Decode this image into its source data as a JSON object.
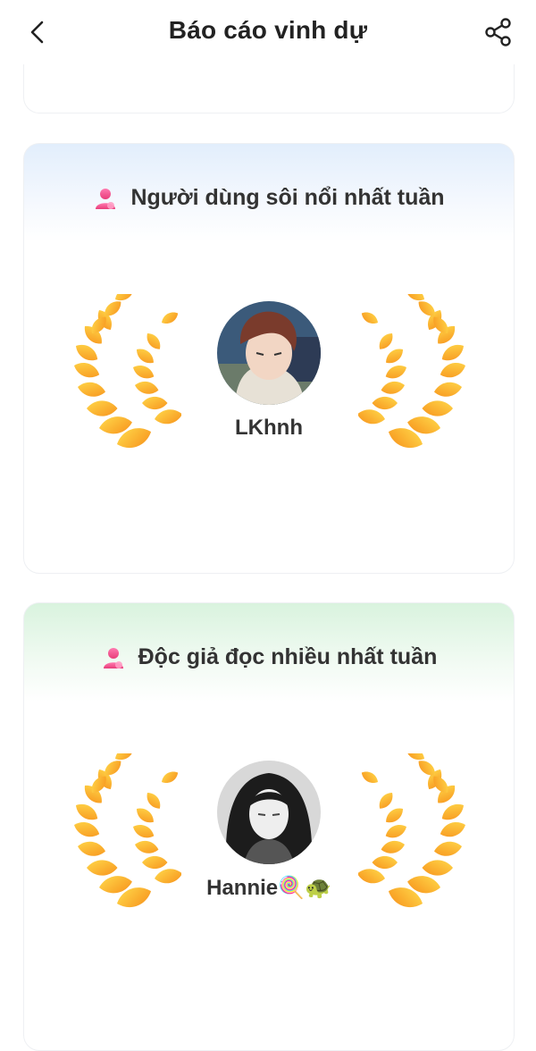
{
  "header": {
    "title": "Báo cáo vinh dự",
    "back_icon": "chevron-left-icon",
    "share_icon": "share-icon"
  },
  "cards": [
    {
      "title": "Người dùng sôi nổi nhất tuần",
      "icon": "user-icon",
      "accent": "#e2eefc",
      "user": {
        "name": "LKhnh"
      }
    },
    {
      "title": "Độc giả đọc nhiều nhất tuần",
      "icon": "user-icon",
      "accent": "#d9f3de",
      "user": {
        "name": "Hannie🍭🐢"
      }
    }
  ],
  "colors": {
    "laurel_light": "#ffd23a",
    "laurel_dark": "#f7941d",
    "user_icon_pink": "#f0508a"
  }
}
